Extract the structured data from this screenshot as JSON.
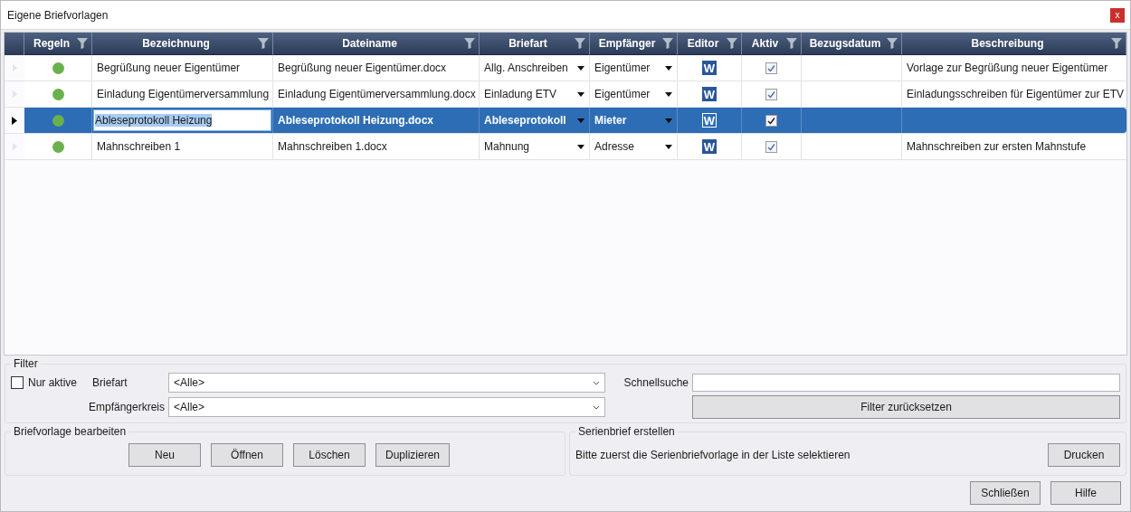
{
  "window": {
    "title": "Eigene Briefvorlagen",
    "close": "x"
  },
  "table": {
    "columns": [
      "Regeln",
      "Bezeichnung",
      "Dateiname",
      "Briefart",
      "Empfänger",
      "Editor",
      "Aktiv",
      "Bezugsdatum",
      "Beschreibung"
    ],
    "rows": [
      {
        "selected": false,
        "color": "#6ab04c",
        "name": "Begrüßung neuer Eigentümer",
        "file": "Begrüßung neuer Eigentümer.docx",
        "type": "Allg. Anschreiben",
        "recipient": "Eigentümer",
        "editor": "W",
        "active": true,
        "description": "Vorlage zur Begrüßung neuer Eigentümer"
      },
      {
        "selected": false,
        "color": "#6ab04c",
        "name": "Einladung Eigentümerversammlung",
        "file": "Einladung Eigentümerversammlung.docx",
        "type": "Einladung ETV",
        "recipient": "Eigentümer",
        "editor": "W",
        "active": true,
        "description": "Einladungsschreiben für Eigentümer zur ETV"
      },
      {
        "selected": true,
        "color": "#6ab04c",
        "name": "Ableseprotokoll Heizung",
        "file": "Ableseprotokoll Heizung.docx",
        "type": "Ableseprotokoll",
        "recipient": "Mieter",
        "editor": "W",
        "active": true
      },
      {
        "selected": false,
        "color": "#6ab04c",
        "name": "Mahnschreiben 1",
        "file": "Mahnschreiben 1.docx",
        "type": "Mahnung",
        "recipient": "Adresse",
        "editor": "W",
        "active": true,
        "description": "Mahnschreiben zur ersten Mahnstufe"
      }
    ]
  },
  "filter": {
    "title": "Filter",
    "only_active": {
      "label": "Nur aktive",
      "checked": false
    },
    "letter_type": {
      "label": "Briefart",
      "value": "<Alle>"
    },
    "recipients": {
      "label": "Empfängerkreis",
      "value": "<Alle>"
    },
    "quick_search": {
      "label": "Schnellsuche"
    },
    "reset_button": "Filter zurücksetzen"
  },
  "edit_group": {
    "title": "Briefvorlage bearbeiten",
    "buttons": [
      "Neu",
      "Öffnen",
      "Löschen",
      "Duplizieren"
    ]
  },
  "serial_group": {
    "title": "Serienbrief erstellen",
    "hint": "Bitte zuerst die Serienbriefvorlage in der Liste selektieren",
    "button": "Drucken"
  },
  "footer_buttons": [
    "Schließen",
    "Hilfe"
  ]
}
